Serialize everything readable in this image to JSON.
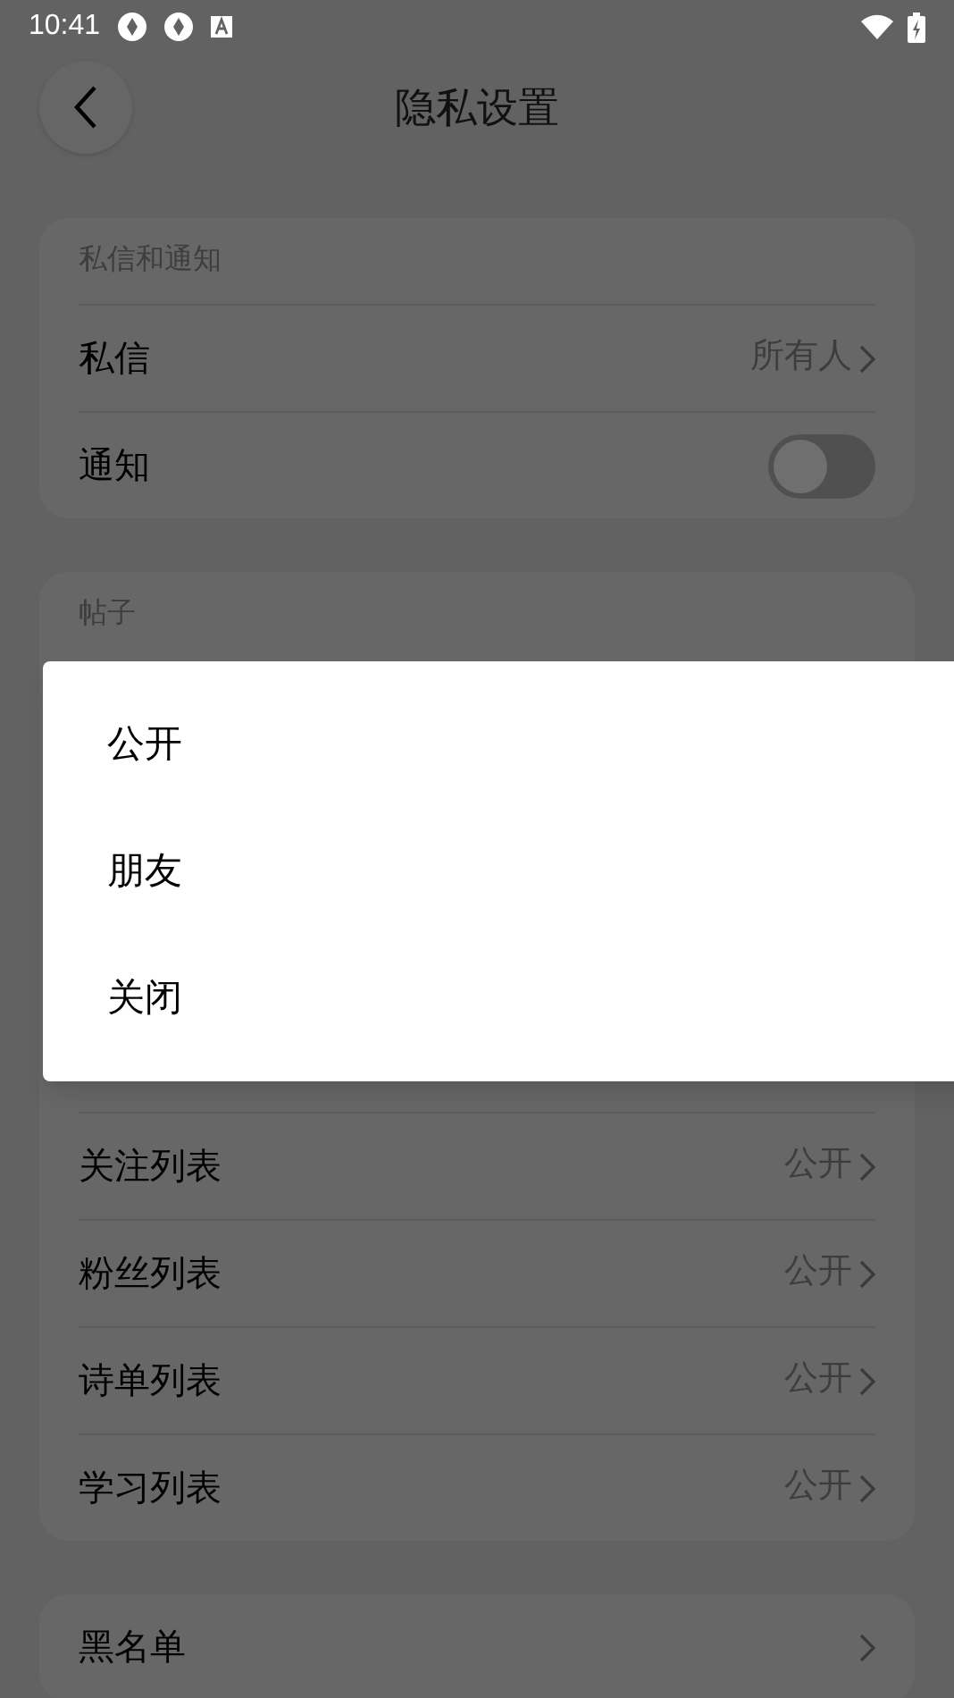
{
  "status_bar": {
    "time": "10:41"
  },
  "header": {
    "title": "隐私设置"
  },
  "sections": [
    {
      "title": "私信和通知",
      "rows": [
        {
          "kind": "value",
          "label": "私信",
          "value": "所有人"
        },
        {
          "kind": "toggle",
          "label": "通知",
          "on": false
        }
      ]
    },
    {
      "title": "帖子",
      "rows": [
        {
          "kind": "value",
          "label": "关注列表",
          "value": "公开"
        },
        {
          "kind": "value",
          "label": "粉丝列表",
          "value": "公开"
        },
        {
          "kind": "value",
          "label": "诗单列表",
          "value": "公开"
        },
        {
          "kind": "value",
          "label": "学习列表",
          "value": "公开"
        }
      ]
    },
    {
      "rows": [
        {
          "kind": "link",
          "label": "黑名单"
        }
      ]
    }
  ],
  "dialog": {
    "options": [
      "公开",
      "朋友",
      "关闭"
    ]
  }
}
